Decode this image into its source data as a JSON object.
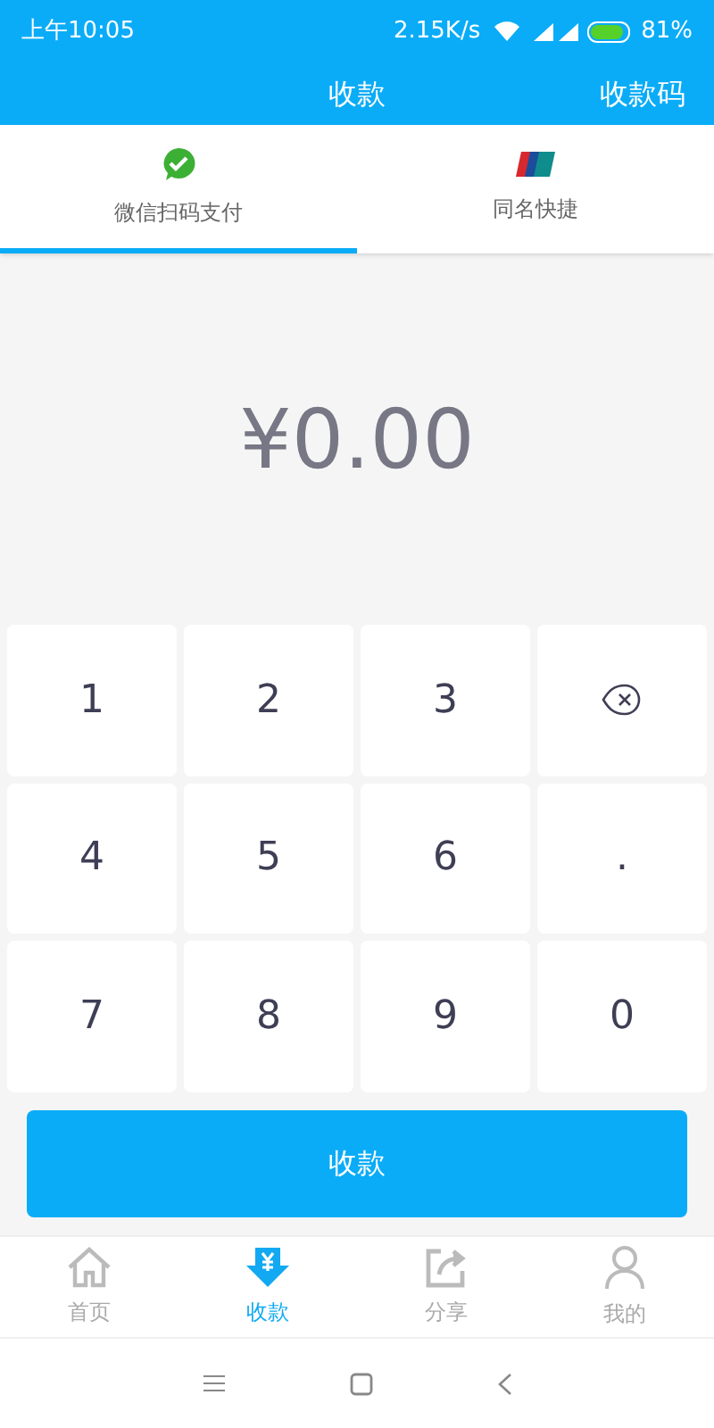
{
  "status_bar": {
    "time": "上午10:05",
    "speed": "2.15K/s",
    "battery": "81%"
  },
  "header": {
    "title": "收款",
    "action": "收款码"
  },
  "tabs": [
    {
      "label": "微信扫码支付",
      "selected": true
    },
    {
      "label": "同名快捷",
      "selected": false
    }
  ],
  "amount": "¥0.00",
  "keypad": [
    {
      "kind": "digit",
      "label": "1"
    },
    {
      "kind": "digit",
      "label": "2"
    },
    {
      "kind": "digit",
      "label": "3"
    },
    {
      "kind": "backspace"
    },
    {
      "kind": "digit",
      "label": "4"
    },
    {
      "kind": "digit",
      "label": "5"
    },
    {
      "kind": "digit",
      "label": "6"
    },
    {
      "kind": "digit",
      "label": "."
    },
    {
      "kind": "digit",
      "label": "7"
    },
    {
      "kind": "digit",
      "label": "8"
    },
    {
      "kind": "digit",
      "label": "9"
    },
    {
      "kind": "digit",
      "label": "0"
    }
  ],
  "submit_button": "收款",
  "bottom_nav": [
    {
      "label": "首页",
      "selected": false
    },
    {
      "label": "收款",
      "selected": true
    },
    {
      "label": "分享",
      "selected": false
    },
    {
      "label": "我的",
      "selected": false
    }
  ]
}
